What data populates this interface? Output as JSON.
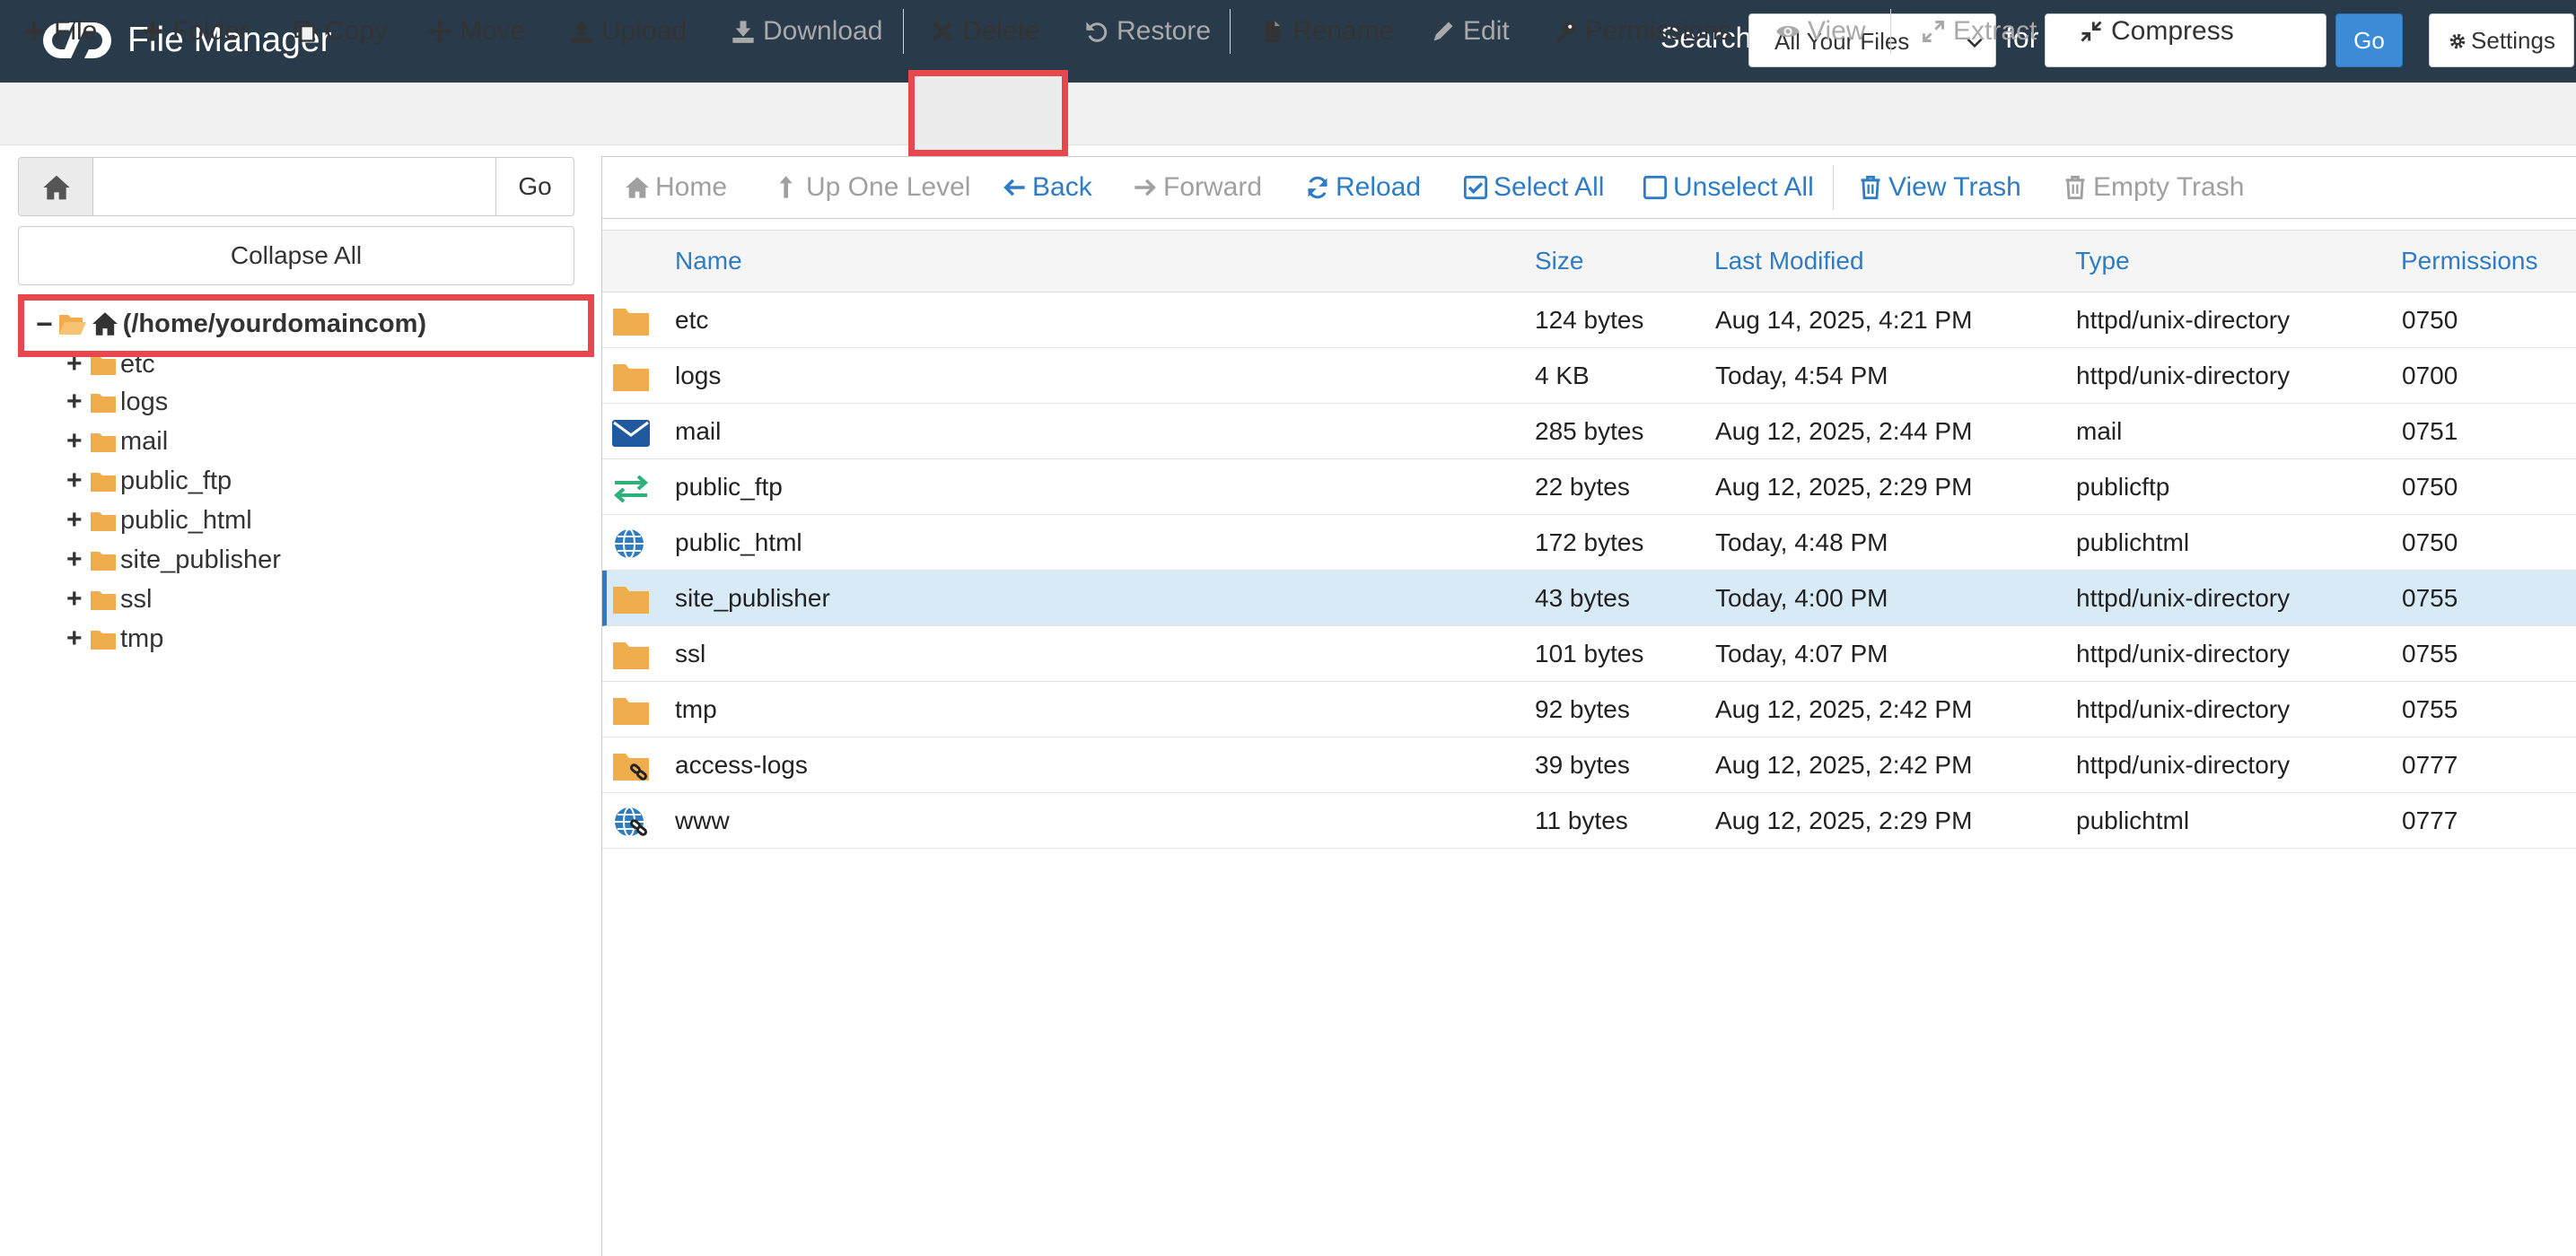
{
  "header": {
    "app_title": "File Manager",
    "search_label": "Search",
    "search_scope": "All Your Files",
    "for_label": "for",
    "search_value": "",
    "go_label": "Go",
    "settings_label": "Settings"
  },
  "toolbar": {
    "file": "File",
    "folder": "Folder",
    "copy": "Copy",
    "move": "Move",
    "upload": "Upload",
    "download": "Download",
    "delete": "Delete",
    "restore": "Restore",
    "rename": "Rename",
    "edit": "Edit",
    "permissions": "Permissions",
    "view": "View",
    "extract": "Extract",
    "compress": "Compress"
  },
  "tree": {
    "path_value": "",
    "go_label": "Go",
    "collapse_all": "Collapse All",
    "root_label": "(/home/yourdomaincom)",
    "items": [
      "etc",
      "logs",
      "mail",
      "public_ftp",
      "public_html",
      "site_publisher",
      "ssl",
      "tmp"
    ]
  },
  "nav": {
    "home": "Home",
    "up_one_level": "Up One Level",
    "back": "Back",
    "forward": "Forward",
    "reload": "Reload",
    "select_all": "Select All",
    "unselect_all": "Unselect All",
    "view_trash": "View Trash",
    "empty_trash": "Empty Trash"
  },
  "table": {
    "columns": [
      "Name",
      "Size",
      "Last Modified",
      "Type",
      "Permissions"
    ],
    "rows": [
      {
        "icon": "folder-icon",
        "name": "etc",
        "size": "124 bytes",
        "modified": "Aug 14, 2025, 4:21 PM",
        "type": "httpd/unix-directory",
        "perms": "0750"
      },
      {
        "icon": "folder-icon",
        "name": "logs",
        "size": "4 KB",
        "modified": "Today, 4:54 PM",
        "type": "httpd/unix-directory",
        "perms": "0700"
      },
      {
        "icon": "mail-icon",
        "name": "mail",
        "size": "285 bytes",
        "modified": "Aug 12, 2025, 2:44 PM",
        "type": "mail",
        "perms": "0751"
      },
      {
        "icon": "ftp-transfer-icon",
        "name": "public_ftp",
        "size": "22 bytes",
        "modified": "Aug 12, 2025, 2:29 PM",
        "type": "publicftp",
        "perms": "0750"
      },
      {
        "icon": "globe-icon",
        "name": "public_html",
        "size": "172 bytes",
        "modified": "Today, 4:48 PM",
        "type": "publichtml",
        "perms": "0750"
      },
      {
        "icon": "folder-icon",
        "name": "site_publisher",
        "size": "43 bytes",
        "modified": "Today, 4:00 PM",
        "type": "httpd/unix-directory",
        "perms": "0755",
        "selected": true
      },
      {
        "icon": "folder-icon",
        "name": "ssl",
        "size": "101 bytes",
        "modified": "Today, 4:07 PM",
        "type": "httpd/unix-directory",
        "perms": "0755"
      },
      {
        "icon": "folder-icon",
        "name": "tmp",
        "size": "92 bytes",
        "modified": "Aug 12, 2025, 2:42 PM",
        "type": "httpd/unix-directory",
        "perms": "0755"
      },
      {
        "icon": "folder-link-icon",
        "name": "access-logs",
        "size": "39 bytes",
        "modified": "Aug 12, 2025, 2:42 PM",
        "type": "httpd/unix-directory",
        "perms": "0777"
      },
      {
        "icon": "globe-link-icon",
        "name": "www",
        "size": "11 bytes",
        "modified": "Aug 12, 2025, 2:29 PM",
        "type": "publichtml",
        "perms": "0777"
      }
    ]
  },
  "colors": {
    "header_bg": "#293a4a",
    "accent_blue": "#2e7cc4",
    "folder_orange": "#f0ad4e",
    "highlight_red": "#e8484d",
    "selected_row": "#d9eaf7"
  }
}
